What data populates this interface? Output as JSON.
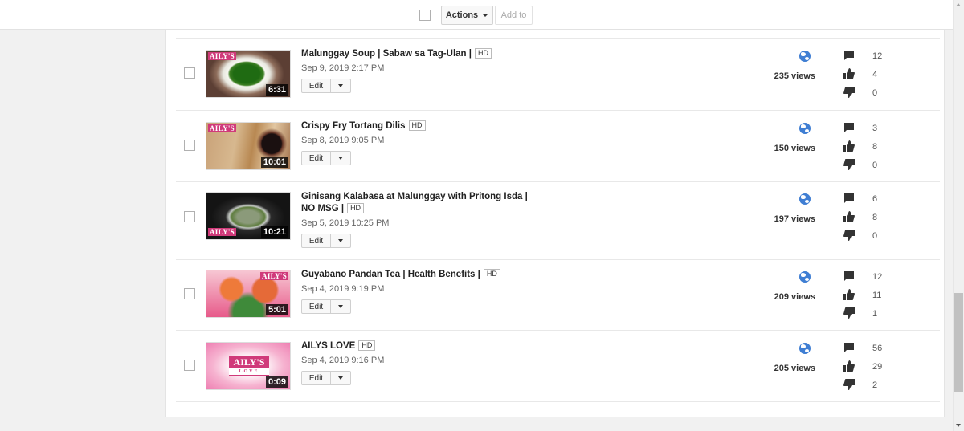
{
  "toolbar": {
    "actions_label": "Actions",
    "add_to_label": "Add to"
  },
  "videos": [
    {
      "title": "Malunggay Soup | Sabaw sa Tag-Ulan |",
      "hd": "HD",
      "date": "Sep 9, 2019 2:17 PM",
      "duration": "6:31",
      "views": "235 views",
      "comments": "12",
      "likes": "4",
      "dislikes": "0",
      "logo": "AILY'S"
    },
    {
      "title": "Crispy Fry Tortang Dilis",
      "hd": "HD",
      "date": "Sep 8, 2019 9:05 PM",
      "duration": "10:01",
      "views": "150 views",
      "comments": "3",
      "likes": "8",
      "dislikes": "0",
      "logo": "AILY'S"
    },
    {
      "title": "Ginisang Kalabasa at Malunggay with Pritong Isda | NO MSG |",
      "hd": "HD",
      "date": "Sep 5, 2019 10:25 PM",
      "duration": "10:21",
      "views": "197 views",
      "comments": "6",
      "likes": "8",
      "dislikes": "0",
      "logo": "AILY'S"
    },
    {
      "title": "Guyabano Pandan Tea | Health Benefits |",
      "hd": "HD",
      "date": "Sep 4, 2019 9:19 PM",
      "duration": "5:01",
      "views": "209 views",
      "comments": "12",
      "likes": "11",
      "dislikes": "1",
      "logo": "AILY'S"
    },
    {
      "title": "AILYS LOVE",
      "hd": "HD",
      "date": "Sep 4, 2019 9:16 PM",
      "duration": "0:09",
      "views": "205 views",
      "comments": "56",
      "likes": "29",
      "dislikes": "2",
      "logo": "AILY'S",
      "logo_sub": "LOVE"
    }
  ],
  "edit_label": "Edit",
  "icons": {
    "visibility": "globe-icon",
    "comments": "comment-icon",
    "likes": "thumbs-up-icon",
    "dislikes": "thumbs-down-icon"
  },
  "colors": {
    "globe": "#3f7ed3",
    "logo_pink": "#d03a7a"
  }
}
